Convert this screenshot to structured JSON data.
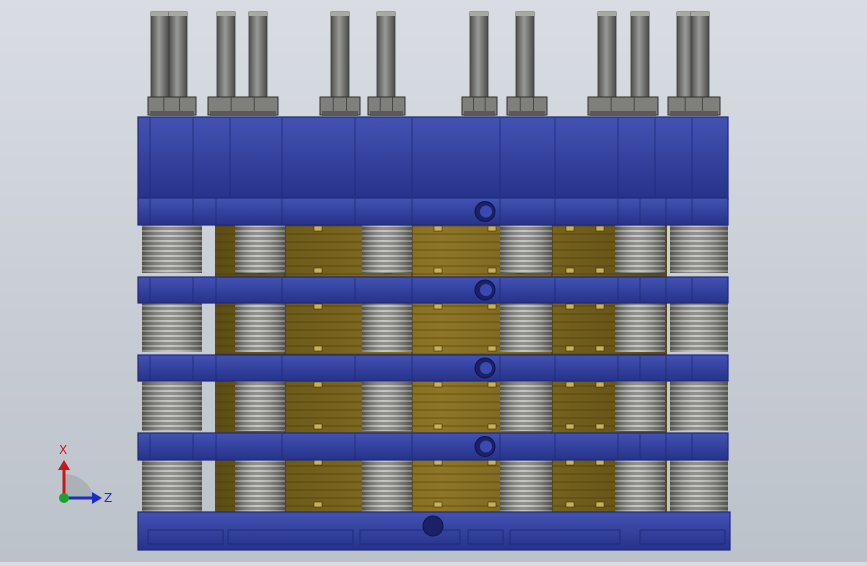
{
  "viewport": {
    "background_top": "#d9dde3",
    "background_bottom": "#bcc2ca",
    "model": {
      "plate_color": "#2f3d9a",
      "plate_dark": "#1f2a78",
      "plate_light": "#4555b8",
      "core_color": "#7a6520",
      "core_light": "#a0852e",
      "spring_color": "#8a8a86",
      "spring_light": "#c4c4bf",
      "bolt_color": "#6c6c6a",
      "nut_color": "#7f7f7c"
    }
  },
  "triad": {
    "x_label": "X",
    "z_label": "Z",
    "x_color": "#c21a1a",
    "z_color": "#1b2fc4",
    "y_color": "#1aa12f"
  }
}
